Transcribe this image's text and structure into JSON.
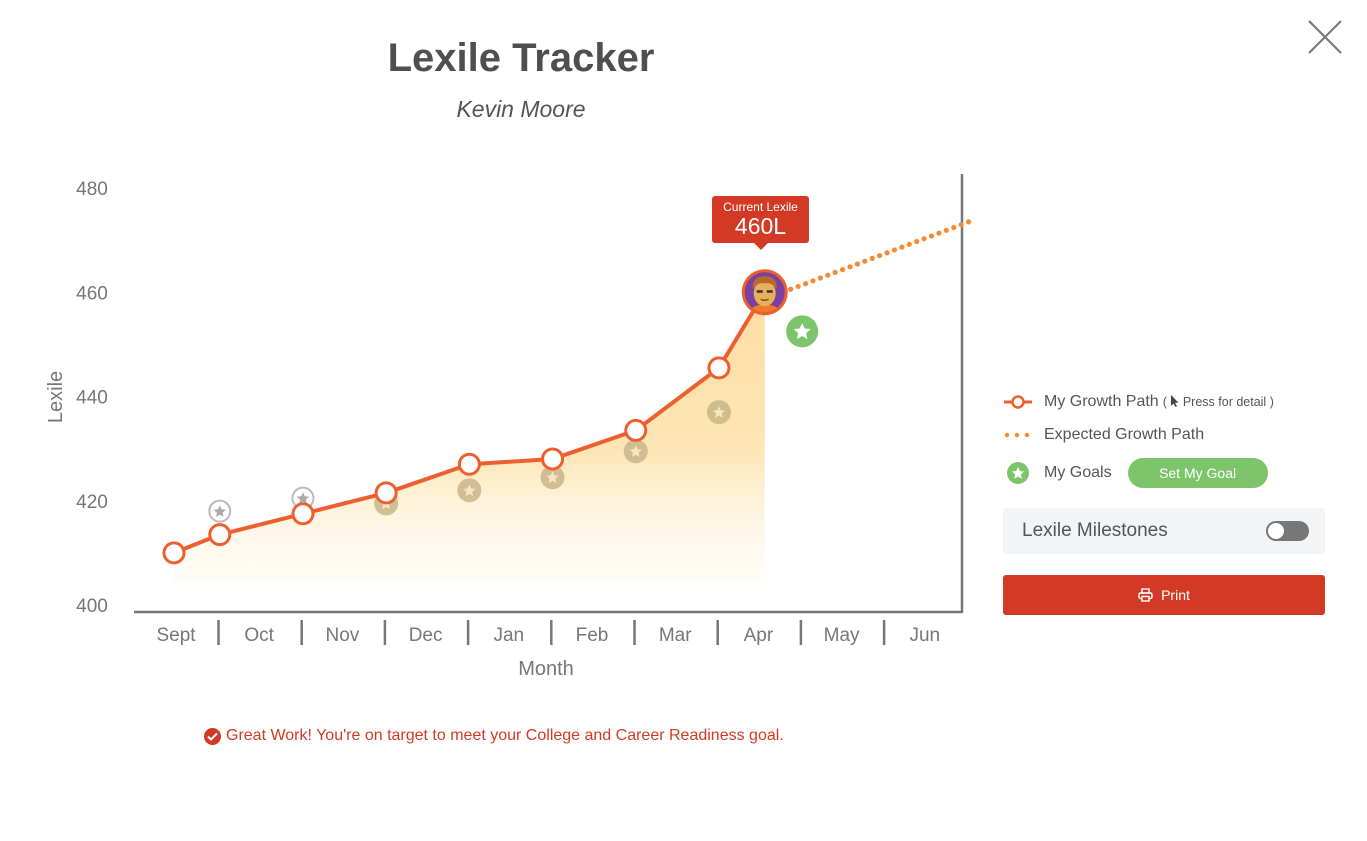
{
  "header": {
    "title": "Lexile Tracker",
    "student_name": "Kevin Moore"
  },
  "close_icon": "close-icon",
  "colors": {
    "growth_line": "#ee5f2f",
    "expected_dots": "#f58a32",
    "goal_green": "#7dc56a",
    "past_goal": "#c9b58a",
    "missed_goal": "#bbbbbb",
    "area_fill": "#fde2a8",
    "accent_red": "#d33a25"
  },
  "tooltip": {
    "label": "Current Lexile",
    "value": "460L"
  },
  "legend": {
    "growth_path": "My Growth Path",
    "growth_hint_open": "(",
    "growth_hint": "Press for detail",
    "growth_hint_close": ")",
    "expected_path": "Expected Growth Path",
    "my_goals": "My Goals",
    "set_goal_button": "Set My Goal"
  },
  "milestones": {
    "label": "Lexile Milestones",
    "enabled": false
  },
  "print_button": "Print",
  "message": "Great Work! You're on target to meet your College and Career Readiness goal.",
  "chart_data": {
    "type": "line",
    "title": "Lexile Tracker",
    "subtitle": "Kevin Moore",
    "xlabel": "Month",
    "ylabel": "Lexile",
    "categories": [
      "Sept",
      "Oct",
      "Nov",
      "Dec",
      "Jan",
      "Feb",
      "Mar",
      "Apr",
      "May",
      "Jun"
    ],
    "ylim": [
      400,
      480
    ],
    "yticks": [
      400,
      420,
      440,
      460,
      480
    ],
    "grid": false,
    "legend_position": "right",
    "series": [
      {
        "name": "My Growth Path",
        "style": "solid-with-markers",
        "points": [
          {
            "x": 0.0,
            "y": 410
          },
          {
            "x": 0.55,
            "y": 413.5
          },
          {
            "x": 1.55,
            "y": 417.5
          },
          {
            "x": 2.55,
            "y": 421.5
          },
          {
            "x": 3.55,
            "y": 427
          },
          {
            "x": 4.55,
            "y": 428
          },
          {
            "x": 5.55,
            "y": 433.5
          },
          {
            "x": 6.55,
            "y": 445.5
          },
          {
            "x": 7.1,
            "y": 460
          }
        ]
      },
      {
        "name": "Expected Growth Path",
        "style": "dotted",
        "points": [
          {
            "x": 7.1,
            "y": 460
          },
          {
            "x": 9.55,
            "y": 473.5
          }
        ]
      },
      {
        "name": "My Goals",
        "style": "star-markers",
        "points": [
          {
            "x": 0.55,
            "y": 418,
            "status": "missed"
          },
          {
            "x": 1.55,
            "y": 420.5,
            "status": "missed"
          },
          {
            "x": 2.55,
            "y": 419.5,
            "status": "past"
          },
          {
            "x": 3.55,
            "y": 422,
            "status": "past"
          },
          {
            "x": 4.55,
            "y": 424.5,
            "status": "past"
          },
          {
            "x": 5.55,
            "y": 429.5,
            "status": "past"
          },
          {
            "x": 6.55,
            "y": 437,
            "status": "past"
          },
          {
            "x": 7.55,
            "y": 452.5,
            "status": "current"
          }
        ]
      }
    ],
    "current_value_label": "460L",
    "current_marker": "student-avatar"
  }
}
